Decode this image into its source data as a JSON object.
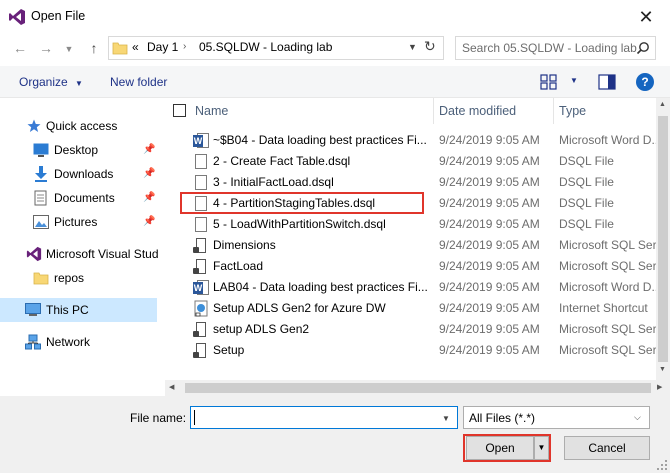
{
  "window": {
    "title": "Open File"
  },
  "address": {
    "prefix": "«",
    "crumbs": [
      "Day 1",
      "05.SQLDW - Loading lab"
    ]
  },
  "search": {
    "placeholder": "Search 05.SQLDW - Loading lab"
  },
  "toolbar": {
    "organize_label": "Organize",
    "new_folder_label": "New folder"
  },
  "sidebar": {
    "items": [
      {
        "label": "Quick access",
        "icon": "star-icon",
        "pinned": false
      },
      {
        "label": "Desktop",
        "icon": "desktop-icon",
        "pinned": true
      },
      {
        "label": "Downloads",
        "icon": "download-icon",
        "pinned": true
      },
      {
        "label": "Documents",
        "icon": "documents-icon",
        "pinned": true
      },
      {
        "label": "Pictures",
        "icon": "pictures-icon",
        "pinned": true
      },
      {
        "label": "Microsoft Visual Stud",
        "icon": "visual-studio-icon",
        "pinned": false
      },
      {
        "label": "repos",
        "icon": "folder-icon",
        "pinned": false
      },
      {
        "label": "This PC",
        "icon": "computer-icon",
        "pinned": false,
        "selected": true
      },
      {
        "label": "Network",
        "icon": "network-icon",
        "pinned": false
      }
    ]
  },
  "columns": {
    "name": "Name",
    "date": "Date modified",
    "type": "Type"
  },
  "files": [
    {
      "name": "~$B04 - Data loading best practices Fi...",
      "date": "9/24/2019 9:05 AM",
      "type": "Microsoft Word D...",
      "icon": "word-icon"
    },
    {
      "name": "2 - Create Fact Table.dsql",
      "date": "9/24/2019 9:05 AM",
      "type": "DSQL File",
      "icon": "file-icon"
    },
    {
      "name": "3 - InitialFactLoad.dsql",
      "date": "9/24/2019 9:05 AM",
      "type": "DSQL File",
      "icon": "file-icon"
    },
    {
      "name": "4 - PartitionStagingTables.dsql",
      "date": "9/24/2019 9:05 AM",
      "type": "DSQL File",
      "icon": "file-icon",
      "highlighted": true
    },
    {
      "name": "5 - LoadWithPartitionSwitch.dsql",
      "date": "9/24/2019 9:05 AM",
      "type": "DSQL File",
      "icon": "file-icon"
    },
    {
      "name": "Dimensions",
      "date": "9/24/2019 9:05 AM",
      "type": "Microsoft SQL Ser...",
      "icon": "sql-icon"
    },
    {
      "name": "FactLoad",
      "date": "9/24/2019 9:05 AM",
      "type": "Microsoft SQL Ser...",
      "icon": "sql-icon"
    },
    {
      "name": "LAB04 - Data loading best practices Fi...",
      "date": "9/24/2019 9:05 AM",
      "type": "Microsoft Word D...",
      "icon": "word-icon"
    },
    {
      "name": "Setup ADLS Gen2 for Azure DW",
      "date": "9/24/2019 9:05 AM",
      "type": "Internet Shortcut",
      "icon": "shortcut-icon"
    },
    {
      "name": "setup ADLS Gen2",
      "date": "9/24/2019 9:05 AM",
      "type": "Microsoft SQL Ser...",
      "icon": "sql-icon"
    },
    {
      "name": "Setup",
      "date": "9/24/2019 9:05 AM",
      "type": "Microsoft SQL Ser...",
      "icon": "sql-icon"
    }
  ],
  "footer": {
    "filename_label": "File name:",
    "filename_value": "",
    "filter_value": "All Files (*.*)",
    "open_label": "Open",
    "cancel_label": "Cancel"
  },
  "colors": {
    "accent": "#0078d7",
    "highlight_box": "#e0352b",
    "selected_nav": "#cce8ff",
    "help": "#1565c0"
  }
}
